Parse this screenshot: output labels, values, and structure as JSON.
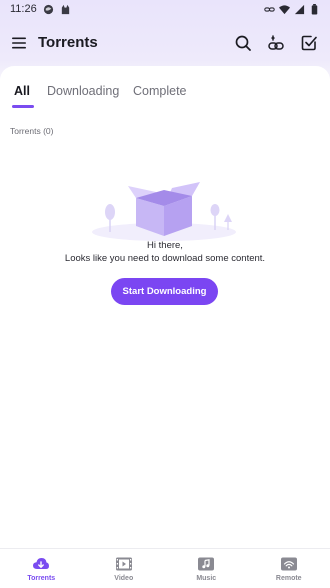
{
  "status_bar": {
    "time": "11:26"
  },
  "app_bar": {
    "title": "Torrents"
  },
  "tabs": [
    {
      "label": "All",
      "active": true
    },
    {
      "label": "Downloading",
      "active": false
    },
    {
      "label": "Complete",
      "active": false
    }
  ],
  "list": {
    "count_label": "Torrents (0)"
  },
  "empty_state": {
    "line1": "Hi there,",
    "line2": "Looks like you need to download some content.",
    "button_label": "Start Downloading"
  },
  "bottom_nav": [
    {
      "label": "Torrents",
      "icon": "cloud-download-icon",
      "active": true
    },
    {
      "label": "Video",
      "icon": "film-icon",
      "active": false
    },
    {
      "label": "Music",
      "icon": "music-icon",
      "active": false
    },
    {
      "label": "Remote",
      "icon": "remote-icon",
      "active": false
    }
  ],
  "colors": {
    "accent": "#7b46f2",
    "background_tint": "#eeeafb"
  }
}
